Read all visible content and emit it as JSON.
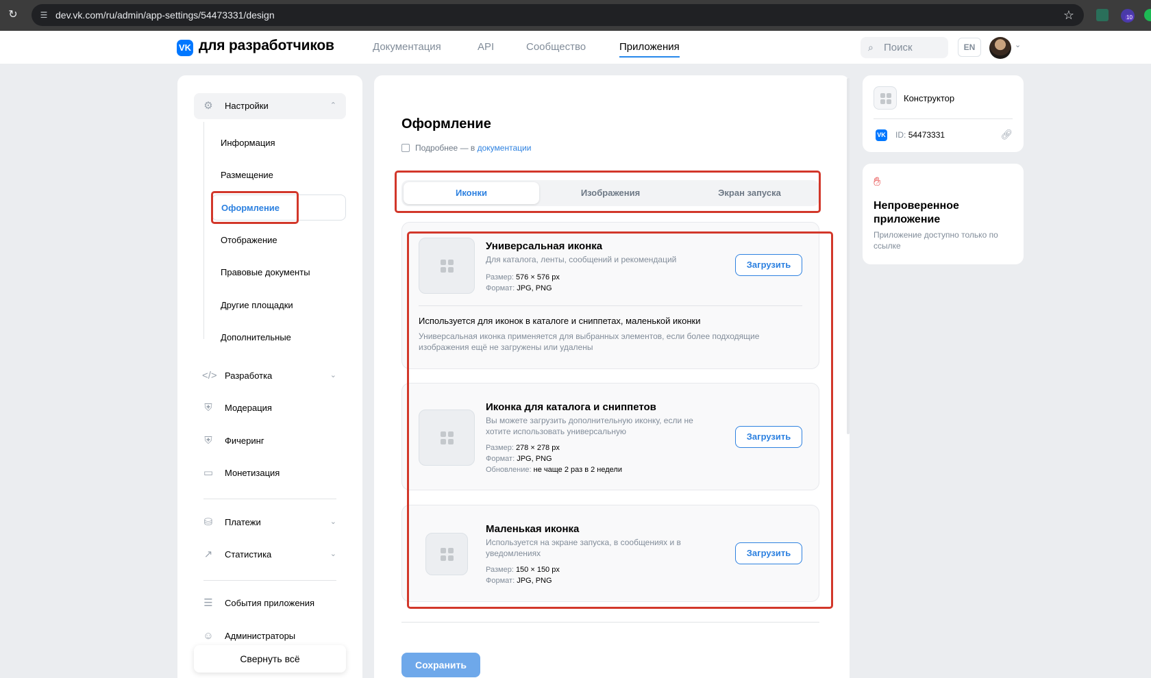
{
  "browser": {
    "url": "dev.vk.com/ru/admin/app-settings/54473331/design",
    "ext_badge": "10"
  },
  "header": {
    "logo_mark": "VK",
    "logo_text": "для разработчиков",
    "nav": [
      "Документация",
      "API",
      "Сообщество",
      "Приложения"
    ],
    "search_placeholder": "Поиск",
    "lang": "EN"
  },
  "sidebar": {
    "settings": {
      "label": "Настройки",
      "chevron": "⌃"
    },
    "settings_items": [
      "Информация",
      "Размещение",
      "Оформление",
      "Отображение",
      "Правовые документы",
      "Другие площадки",
      "Дополнительные"
    ],
    "sections": [
      {
        "label": "Разработка",
        "icon": "code-icon",
        "chevron": "⌄"
      },
      {
        "label": "Модерация",
        "icon": "shield-icon",
        "chevron": ""
      },
      {
        "label": "Фичеринг",
        "icon": "shield-check-icon",
        "chevron": ""
      },
      {
        "label": "Монетизация",
        "icon": "card-icon",
        "chevron": ""
      },
      {
        "label": "Платежи",
        "icon": "coins-icon",
        "chevron": "⌄"
      },
      {
        "label": "Статистика",
        "icon": "chart-icon",
        "chevron": "⌄"
      },
      {
        "label": "События приложения",
        "icon": "list-icon",
        "chevron": ""
      },
      {
        "label": "Администраторы",
        "icon": "user-icon",
        "chevron": ""
      }
    ],
    "collapse_all": "Свернуть всё"
  },
  "main": {
    "title": "Оформление",
    "more_prefix": "Подробнее — в",
    "more_link": "документации",
    "tabs": [
      "Иконки",
      "Изображения",
      "Экран запуска"
    ],
    "cards": [
      {
        "title": "Универсальная иконка",
        "desc": "Для каталога, ленты, сообщений и рекомендаций",
        "size_label": "Размер:",
        "size": "576 × 576 px",
        "format_label": "Формат:",
        "format": "JPG, PNG",
        "upload": "Загрузить",
        "note_title": "Используется для иконок в каталоге и сниппетах, маленькой иконки",
        "note_desc": "Универсальная иконка применяется для выбранных элементов, если более подходящие изображения ещё не загружены или удалены"
      },
      {
        "title": "Иконка для каталога и сниппетов",
        "desc": "Вы можете загрузить дополнительную иконку, если не хотите использовать универсальную",
        "size_label": "Размер:",
        "size": "278 × 278 px",
        "format_label": "Формат:",
        "format": "JPG, PNG",
        "update_label": "Обновление:",
        "update": "не чаще 2 раз в 2 недели",
        "upload": "Загрузить"
      },
      {
        "title": "Маленькая иконка",
        "desc": "Используется на экране запуска, в сообщениях и в уведомлениях",
        "size_label": "Размер:",
        "size": "150 × 150 px",
        "format_label": "Формат:",
        "format": "JPG, PNG",
        "upload": "Загрузить"
      }
    ],
    "save": "Сохранить"
  },
  "right": {
    "app_name": "Конструктор",
    "id_label": "ID:",
    "id_value": "54473331",
    "warn_title": "Непроверенное приложение",
    "warn_desc": "Приложение доступно только по ссылке"
  },
  "colors": {
    "accent": "#2d81e0",
    "brand": "#0077ff",
    "highlight": "#d2372a",
    "save_disabled": "#6ea8ea"
  }
}
